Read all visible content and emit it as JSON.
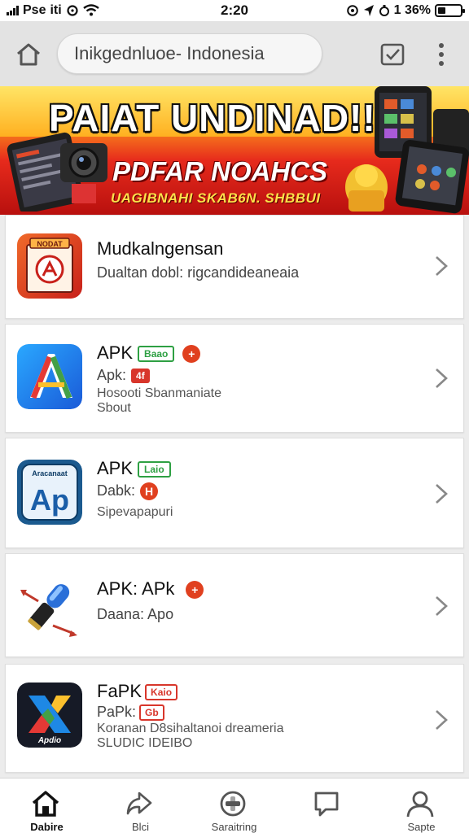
{
  "status_bar": {
    "carrier": "Pse",
    "network": "iti",
    "time": "2:20",
    "battery": "1 36%",
    "battery_level": 0.36
  },
  "browser": {
    "url": "Inikgedn​luoe- Indonesia",
    "home_icon": "home-outline-icon",
    "tabs_icon": "checkbox-icon",
    "menu_icon": "more-vertical-icon"
  },
  "banner": {
    "title": "PAIAT UNDINAD!!",
    "subtitle": "PDFAR NOAHCS",
    "tagline": "UAGIBNAHI SKAB6N. SHBBUI",
    "colors": {
      "top": "#ffd84a",
      "bottom": "#c8140f"
    }
  },
  "apps": [
    {
      "name": "Mudkalngensan",
      "line1": "Dualtan dobl: rigcandideaneaia",
      "line2": "",
      "icon": "pdf-reader-app-icon",
      "icon_caption": "NODAT"
    },
    {
      "name": "APK",
      "name_badge": "Baao",
      "line1": "Apk:",
      "line1_badge": "4f",
      "line2": "Hosooti Sbanmaniate",
      "line3": "Sbout",
      "icon": "apk-a-app-icon"
    },
    {
      "name": "APK",
      "name_badge": "Laio",
      "line1": "Dabk:",
      "line1_badge": "H",
      "line2": "Sipevapapuri",
      "icon": "apk-ap-app-icon",
      "icon_caption": "Aracanaat"
    },
    {
      "name": "APK: APk",
      "line1": "Daana: Apo",
      "line2": "",
      "icon": "microphone-app-icon"
    },
    {
      "name": "FaPK",
      "name_badge": "Kaio",
      "line1": "PaPk:",
      "line1_badge": "Gb",
      "line2": "Koranan D8sihaltanoi dreameria",
      "line3": "SLUDIC IDEIBO",
      "icon": "x-app-icon",
      "icon_caption": "Apdio"
    }
  ],
  "bottom_nav": [
    {
      "label": "Dabire",
      "icon": "home-icon",
      "active": true
    },
    {
      "label": "Blci",
      "icon": "share-arrow-icon",
      "active": false
    },
    {
      "label": "Saraitring",
      "icon": "settings-circle-icon",
      "active": false
    },
    {
      "label": "",
      "icon": "chat-bubble-icon",
      "active": false
    },
    {
      "label": "Sapte",
      "icon": "user-icon",
      "active": false
    }
  ]
}
